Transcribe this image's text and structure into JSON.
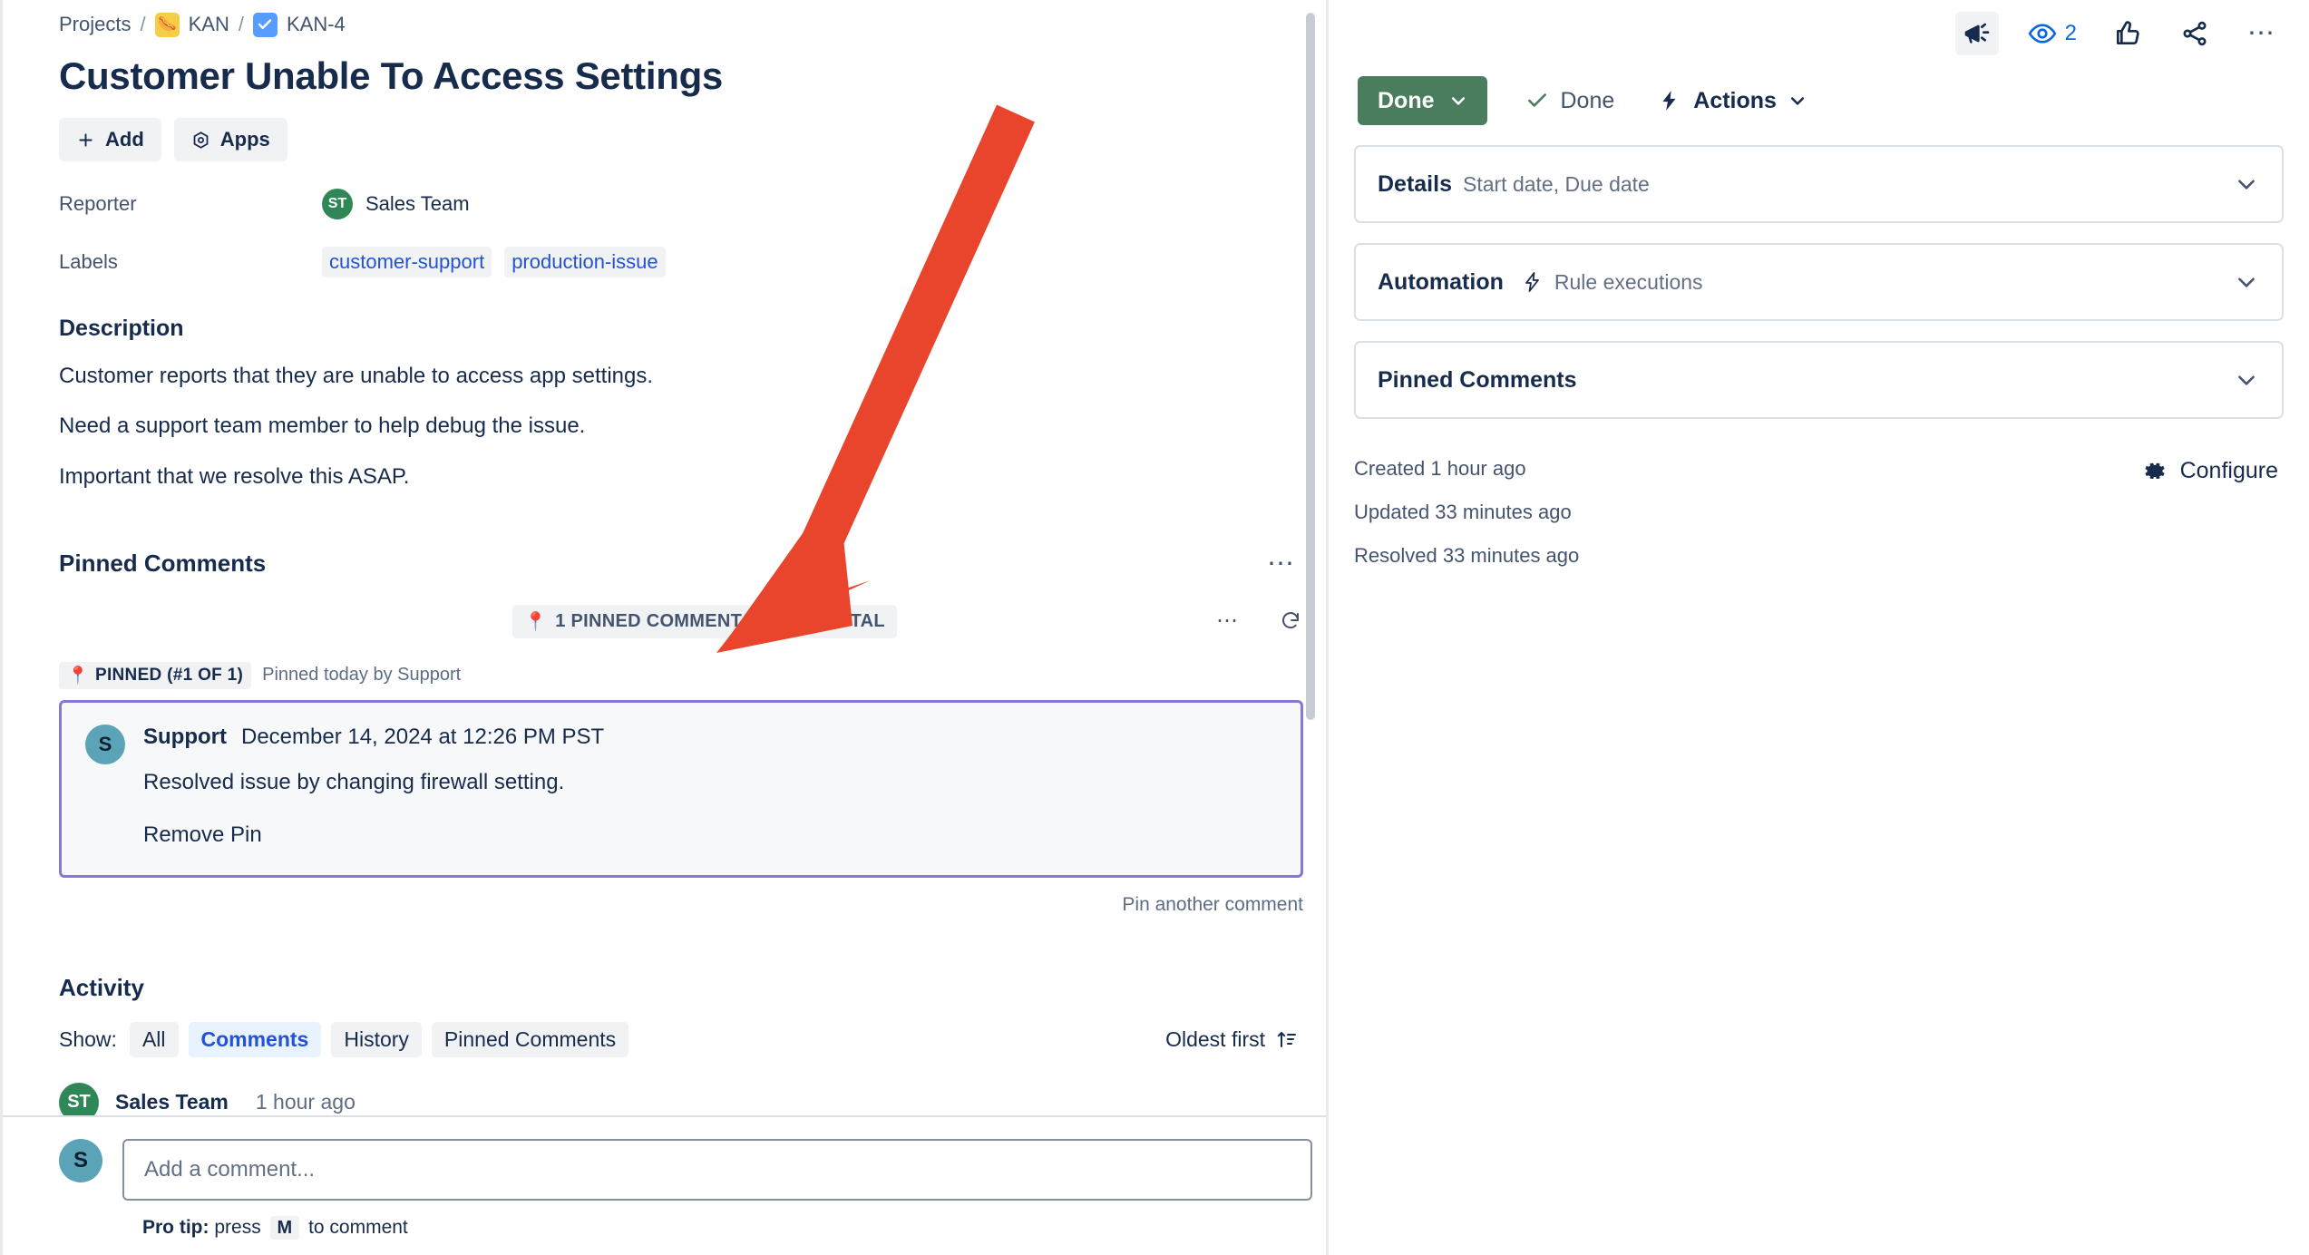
{
  "breadcrumb": {
    "projects": "Projects",
    "sep": "/",
    "project_key": "KAN",
    "issue_key": "KAN-4",
    "project_icon": "hotdog-icon",
    "issue_icon": "task-check-icon"
  },
  "issue": {
    "title": "Customer Unable To Access Settings"
  },
  "toolbar": {
    "add_label": "Add",
    "apps_label": "Apps"
  },
  "fields": {
    "reporter_label": "Reporter",
    "reporter_initials": "ST",
    "reporter_name": "Sales Team",
    "labels_label": "Labels",
    "labels": [
      "customer-support",
      "production-issue"
    ]
  },
  "description": {
    "heading": "Description",
    "paragraphs": [
      "Customer reports that they are unable to access app settings.",
      "Need a support team member to help debug the issue.",
      "Important that we resolve this ASAP."
    ]
  },
  "pinned": {
    "heading": "Pinned Comments",
    "chip_pinned": "1 PINNED COMMENT",
    "chip_total": "4 TOTAL",
    "badge": "PINNED (#1 OF 1)",
    "pinned_by": "Pinned today by Support",
    "author_initial": "S",
    "author": "Support",
    "date": "December 14, 2024 at 12:26 PM PST",
    "text": "Resolved issue by changing firewall setting.",
    "remove_label": "Remove Pin",
    "pin_another": "Pin another comment"
  },
  "activity": {
    "heading": "Activity",
    "show_label": "Show:",
    "filters": [
      {
        "label": "All",
        "active": false
      },
      {
        "label": "Comments",
        "active": true
      },
      {
        "label": "History",
        "active": false
      },
      {
        "label": "Pinned Comments",
        "active": false
      }
    ],
    "sort_label": "Oldest first",
    "entry": {
      "initials": "ST",
      "name": "Sales Team",
      "time": "1 hour ago"
    }
  },
  "composer": {
    "avatar_initial": "S",
    "placeholder": "Add a comment...",
    "protip_prefix": "Pro tip:",
    "protip_press": "press",
    "protip_key": "M",
    "protip_suffix": "to comment"
  },
  "right": {
    "watch_count": "2",
    "status_label": "Done",
    "done_label": "Done",
    "actions_label": "Actions",
    "panels": [
      {
        "title": "Details",
        "sub": "Start date, Due date",
        "bolt": false
      },
      {
        "title": "Automation",
        "sub": "Rule executions",
        "bolt": true
      },
      {
        "title": "Pinned Comments",
        "sub": "",
        "bolt": false
      }
    ],
    "meta": [
      "Created 1 hour ago",
      "Updated 33 minutes ago",
      "Resolved 33 minutes ago"
    ],
    "configure_label": "Configure"
  },
  "colors": {
    "accent_blue": "#0c66e4",
    "link_blue": "#2352d6",
    "status_green": "#4a7d5e",
    "pin_purple": "#8777d9",
    "arrow_red": "#e8452c",
    "avatar_green": "#2f8757",
    "avatar_teal": "#5ba4b8"
  }
}
